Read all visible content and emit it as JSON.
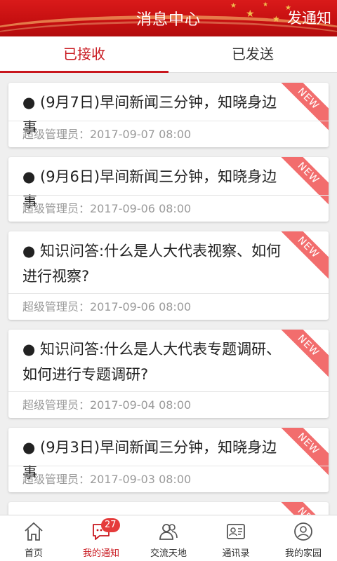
{
  "header": {
    "title": "消息中心",
    "action": "发通知"
  },
  "tabs": [
    {
      "label": "已接收",
      "active": true
    },
    {
      "label": "已发送",
      "active": false
    }
  ],
  "messages": [
    {
      "title": "● (9月7日)早间新闻三分钟，知晓身边事",
      "sender": "超级管理员：2017-09-07 08:00",
      "badge": "NEW"
    },
    {
      "title": "● (9月6日)早间新闻三分钟，知晓身边事",
      "sender": "超级管理员：2017-09-06 08:00",
      "badge": "NEW"
    },
    {
      "title": "● 知识问答:什么是人大代表视察、如何进行视察?",
      "sender": "超级管理员：2017-09-06 08:00",
      "badge": "NEW"
    },
    {
      "title": "● 知识问答:什么是人大代表专题调研、如何进行专题调研?",
      "sender": "超级管理员：2017-09-04 08:00",
      "badge": "NEW"
    },
    {
      "title": "● (9月3日)早间新闻三分钟，知晓身边事",
      "sender": "超级管理员：2017-09-03 08:00",
      "badge": "NEW"
    },
    {
      "title": "",
      "sender": "",
      "badge": "NEW"
    }
  ],
  "tabbar": [
    {
      "label": "首页",
      "icon": "home-icon"
    },
    {
      "label": "我的通知",
      "icon": "chat-bubble-icon",
      "badge": "27",
      "active": true
    },
    {
      "label": "交流天地",
      "icon": "users-icon"
    },
    {
      "label": "通讯录",
      "icon": "contact-card-icon"
    },
    {
      "label": "我的家园",
      "icon": "profile-icon"
    }
  ],
  "colors": {
    "brand_red": "#c8161d",
    "ribbon": "#f26d6d"
  }
}
